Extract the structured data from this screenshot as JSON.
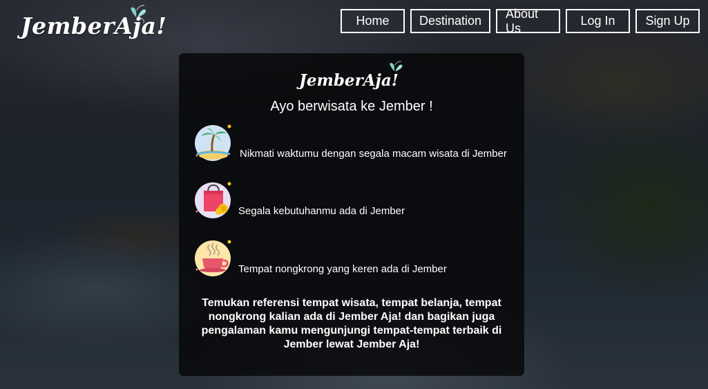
{
  "brand": {
    "logo_text": "JemberAja!"
  },
  "nav": {
    "home": "Home",
    "destination": "Destination",
    "about": "About Us",
    "login": "Log In",
    "signup": "Sign Up"
  },
  "card": {
    "logo_text": "JemberAja!",
    "title": "Ayo berwisata ke Jember !",
    "features": [
      {
        "icon": "beach-palm-icon",
        "text": "Nikmati waktumu dengan segala macam wisata di Jember"
      },
      {
        "icon": "shopping-bag-icon",
        "text": "Segala kebutuhanmu ada di Jember"
      },
      {
        "icon": "coffee-cup-icon",
        "text": "Tempat nongkrong yang keren ada di Jember"
      }
    ],
    "description": "Temukan referensi tempat wisata, tempat belanja, tempat nongkrong kalian ada di Jember Aja! dan bagikan juga pengalaman kamu mengunjungi tempat-tempat terbaik di Jember lewat Jember Aja!"
  },
  "colors": {
    "card_bg": "#0a0a0c",
    "beach_circle": "#cfe3f5",
    "shop_circle": "#e8dff5",
    "coffee_circle": "#fde6a8",
    "butterfly": "#7fd6c8"
  }
}
